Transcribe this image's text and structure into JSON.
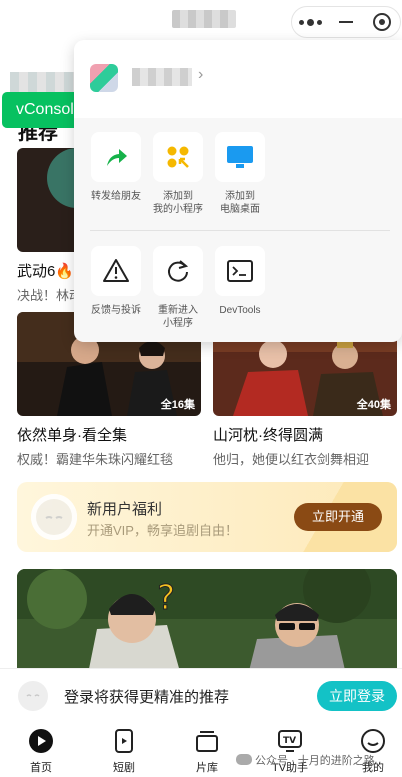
{
  "topbar": {
    "capsule": {
      "more": "more-icon",
      "minimize": "minus-icon",
      "close": "target-icon"
    }
  },
  "vconsole": {
    "label": "vConsole"
  },
  "section": {
    "title": "推荐"
  },
  "videos": [
    {
      "title": "武动6🔥",
      "subtitle": "决战！林动",
      "badge": ""
    },
    {
      "title": "",
      "subtitle": "",
      "badge": ""
    },
    {
      "title": "依然单身·看全集",
      "subtitle": "权威！霸建华朱珠闪耀红毯",
      "badge": "全16集"
    },
    {
      "title": "山河枕·终得圆满",
      "subtitle": "他归，她便以红衣剑舞相迎",
      "badge": "全40集"
    }
  ],
  "promo": {
    "title": "新用户福利",
    "subtitle": "开通VIP，畅享追剧自由！",
    "button": "立即开通"
  },
  "login": {
    "text": "登录将获得更精准的推荐",
    "button": "立即登录"
  },
  "tabs": [
    {
      "label": "首页",
      "icon": "play-icon"
    },
    {
      "label": "短剧",
      "icon": "short-drama-icon"
    },
    {
      "label": "片库",
      "icon": "library-icon"
    },
    {
      "label": "TV助手",
      "icon": "tv-icon"
    },
    {
      "label": "我的",
      "icon": "profile-icon"
    }
  ],
  "watermark": {
    "text": "公众号 · 十月的进阶之路"
  },
  "menu": {
    "chevron": "›",
    "row1": [
      {
        "label": "转发给朋友",
        "icon": "share-icon"
      },
      {
        "label": "添加到\n我的小程序",
        "icon": "add-miniprogram-icon"
      },
      {
        "label": "添加到\n电脑桌面",
        "icon": "desktop-icon"
      }
    ],
    "row2": [
      {
        "label": "反馈与投诉",
        "icon": "warning-icon"
      },
      {
        "label": "重新进入\n小程序",
        "icon": "reload-icon"
      },
      {
        "label": "DevTools",
        "icon": "terminal-icon"
      }
    ]
  },
  "colors": {
    "green": "#07c160",
    "teal": "#13c2c6",
    "promo_button": "#8a4a14",
    "share_green": "#16b24a",
    "desktop_blue": "#1a9af0"
  }
}
